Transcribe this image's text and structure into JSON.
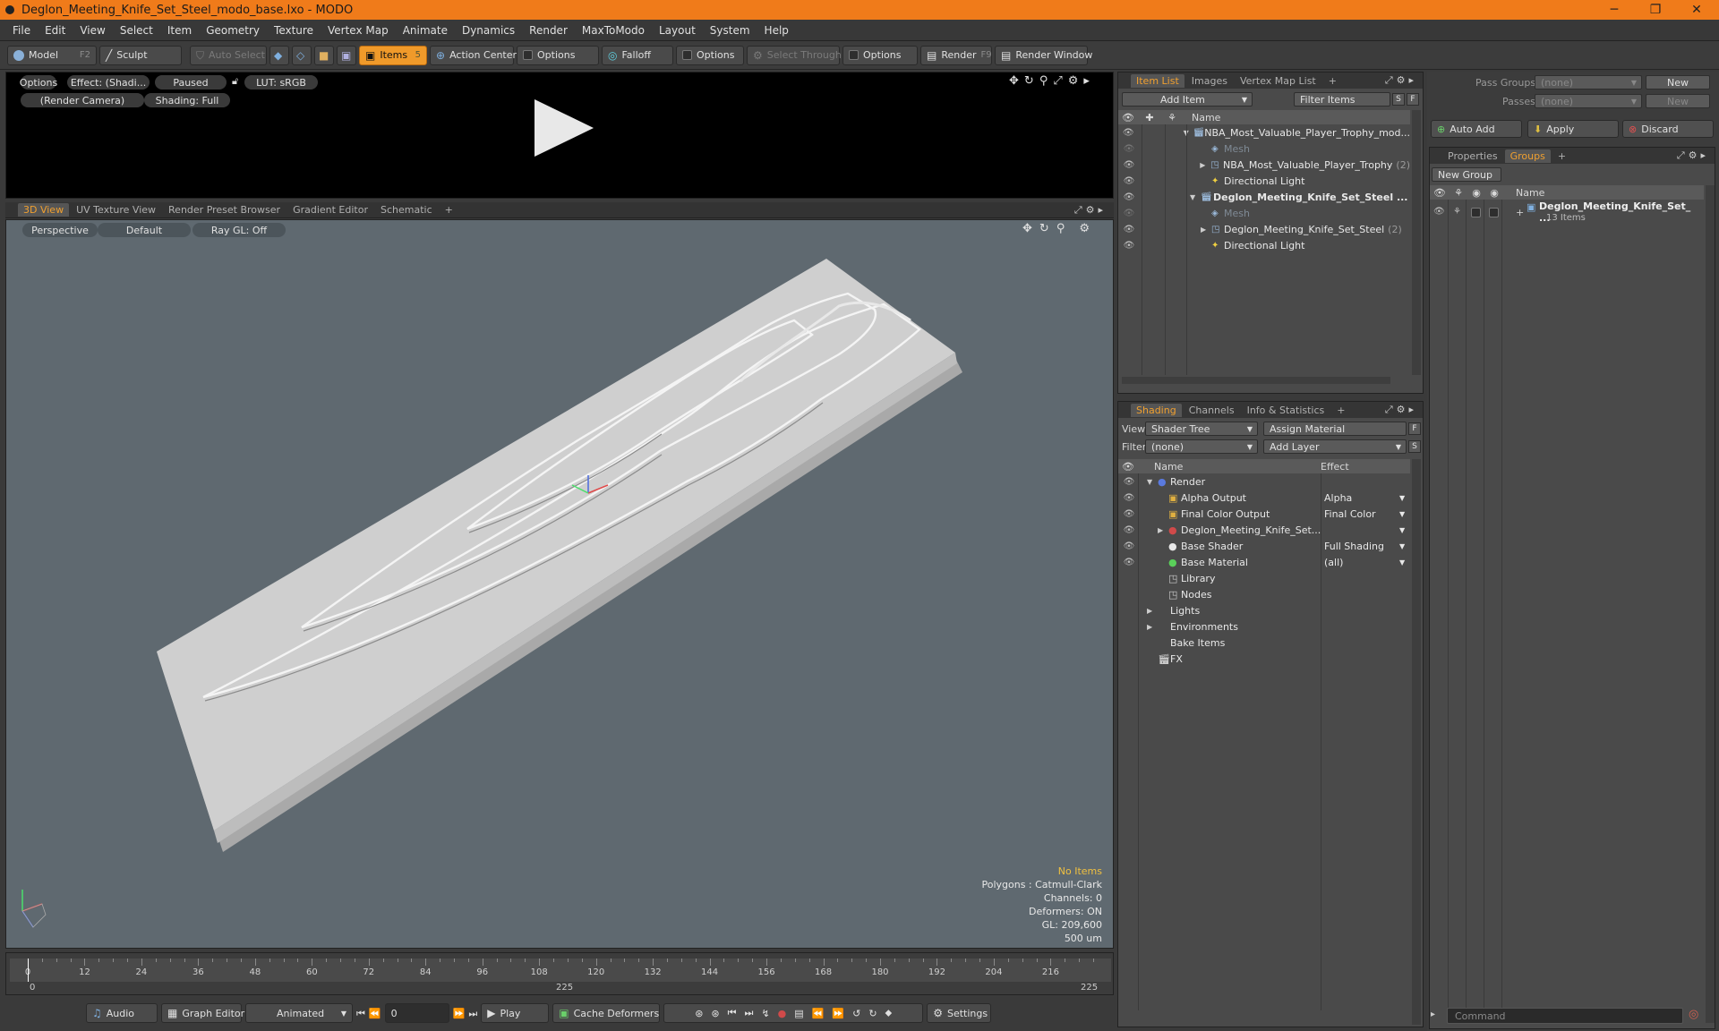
{
  "window": {
    "title": "Deglon_Meeting_Knife_Set_Steel_modo_base.lxo - MODO",
    "minimize": "─",
    "maximize": "❐",
    "close": "✕"
  },
  "menu": [
    "File",
    "Edit",
    "View",
    "Select",
    "Item",
    "Geometry",
    "Texture",
    "Vertex Map",
    "Animate",
    "Dynamics",
    "Render",
    "MaxToModo",
    "Layout",
    "System",
    "Help"
  ],
  "toolbar": {
    "model": "Model",
    "model_key": "F2",
    "sculpt": "Sculpt",
    "auto_select": "Auto Select",
    "items": "Items",
    "items_key": "5",
    "action_center": "Action Center",
    "options1": "Options",
    "falloff": "Falloff",
    "options2": "Options",
    "select_through": "Select Through",
    "options3": "Options",
    "render": "Render",
    "render_key": "F9",
    "render_window": "Render Window"
  },
  "preview": {
    "options": "Options",
    "effect": "Effect: (Shadi...",
    "paused": "Paused",
    "lut": "LUT: sRGB",
    "camera": "(Render Camera)",
    "shading": "Shading: Full"
  },
  "viewport_tabs": [
    "3D View",
    "UV Texture View",
    "Render Preset Browser",
    "Gradient Editor",
    "Schematic",
    "+"
  ],
  "viewport": {
    "perspective": "Perspective",
    "default": "Default",
    "raygl": "Ray GL: Off"
  },
  "stats": {
    "no_items": "No Items",
    "polygons": "Polygons : Catmull-Clark",
    "channels": "Channels: 0",
    "deformers": "Deformers: ON",
    "gl": "GL: 209,600",
    "unit": "500 um"
  },
  "timeline": {
    "labels": [
      "0",
      "12",
      "24",
      "36",
      "48",
      "60",
      "72",
      "84",
      "96",
      "108",
      "120",
      "132",
      "144",
      "156",
      "168",
      "180",
      "192",
      "204",
      "216"
    ],
    "start": "0",
    "mid": "225",
    "end": "225"
  },
  "bottom": {
    "audio": "Audio",
    "graph_editor": "Graph Editor",
    "animated": "Animated",
    "frame": "0",
    "play": "Play",
    "cache_deformers": "Cache Deformers",
    "settings": "Settings"
  },
  "item_list": {
    "tabs": [
      "Item List",
      "Images",
      "Vertex Map List",
      "+"
    ],
    "add_item": "Add Item",
    "filter_items": "Filter Items",
    "s": "S",
    "f": "F",
    "name_col": "Name",
    "rows": [
      {
        "label": "NBA_Most_Valuable_Player_Trophy_mod...",
        "indent": 0,
        "bold": false,
        "dim": false,
        "exp": "▼",
        "icon": "scene-icon"
      },
      {
        "label": "Mesh",
        "indent": 1,
        "bold": false,
        "dim": true,
        "exp": "",
        "icon": "mesh-icon"
      },
      {
        "label": "NBA_Most_Valuable_Player_Trophy",
        "count": "(2)",
        "indent": 1,
        "bold": false,
        "dim": false,
        "exp": "▶",
        "icon": "group-icon"
      },
      {
        "label": "Directional Light",
        "indent": 1,
        "bold": false,
        "dim": false,
        "exp": "",
        "icon": "light-icon"
      },
      {
        "label": "Deglon_Meeting_Knife_Set_Steel ...",
        "indent": 0,
        "bold": true,
        "dim": false,
        "exp": "▼",
        "icon": "scene-icon"
      },
      {
        "label": "Mesh",
        "indent": 1,
        "bold": false,
        "dim": true,
        "exp": "",
        "icon": "mesh-icon"
      },
      {
        "label": "Deglon_Meeting_Knife_Set_Steel",
        "count": "(2)",
        "indent": 1,
        "bold": false,
        "dim": false,
        "exp": "▶",
        "icon": "group-icon"
      },
      {
        "label": "Directional Light",
        "indent": 1,
        "bold": false,
        "dim": false,
        "exp": "",
        "icon": "light-icon"
      }
    ]
  },
  "shading": {
    "tabs": [
      "Shading",
      "Channels",
      "Info & Statistics",
      "+"
    ],
    "view_label": "View",
    "view_value": "Shader Tree",
    "assign_material": "Assign Material",
    "f": "F",
    "filter_label": "Filter",
    "filter_value": "(none)",
    "add_layer": "Add Layer",
    "s": "S",
    "name_col": "Name",
    "effect_col": "Effect",
    "rows": [
      {
        "label": "Render",
        "effect": "",
        "indent": 0,
        "exp": "▼",
        "eye": true,
        "icon": "sphere-blue"
      },
      {
        "label": "Alpha Output",
        "effect": "Alpha",
        "indent": 1,
        "exp": "",
        "eye": true,
        "icon": "output"
      },
      {
        "label": "Final Color Output",
        "effect": "Final Color",
        "indent": 1,
        "exp": "",
        "eye": true,
        "icon": "output"
      },
      {
        "label": "Deglon_Meeting_Knife_Set...",
        "effect": "",
        "indent": 1,
        "exp": "▶",
        "eye": true,
        "icon": "material-red"
      },
      {
        "label": "Base Shader",
        "effect": "Full Shading",
        "indent": 1,
        "exp": "",
        "eye": true,
        "icon": "sphere-white"
      },
      {
        "label": "Base Material",
        "effect": "(all)",
        "indent": 1,
        "exp": "",
        "eye": true,
        "icon": "sphere-green"
      },
      {
        "label": "Library",
        "effect": "",
        "indent": 1,
        "exp": "",
        "eye": false,
        "icon": "folder"
      },
      {
        "label": "Nodes",
        "effect": "",
        "indent": 1,
        "exp": "",
        "eye": false,
        "icon": "folder"
      },
      {
        "label": "Lights",
        "effect": "",
        "indent": 0,
        "exp": "▶",
        "eye": false,
        "icon": ""
      },
      {
        "label": "Environments",
        "effect": "",
        "indent": 0,
        "exp": "▶",
        "eye": false,
        "icon": ""
      },
      {
        "label": "Bake Items",
        "effect": "",
        "indent": 0,
        "exp": "",
        "eye": false,
        "icon": ""
      },
      {
        "label": "FX",
        "effect": "",
        "indent": 0,
        "exp": "",
        "eye": false,
        "icon": "fx"
      }
    ]
  },
  "groups": {
    "pass_groups": "Pass Groups",
    "pass_value": "(none)",
    "new": "New",
    "passes": "Passes",
    "passes_value": "(none)",
    "new2": "New",
    "auto_add": "Auto Add",
    "apply": "Apply",
    "discard": "Discard",
    "tabs": [
      "Properties",
      "Groups",
      "+"
    ],
    "new_group": "New Group",
    "name_col": "Name",
    "item_name": "Deglon_Meeting_Knife_Set_ ...",
    "item_count": "13 Items"
  },
  "command": {
    "placeholder": "Command"
  }
}
